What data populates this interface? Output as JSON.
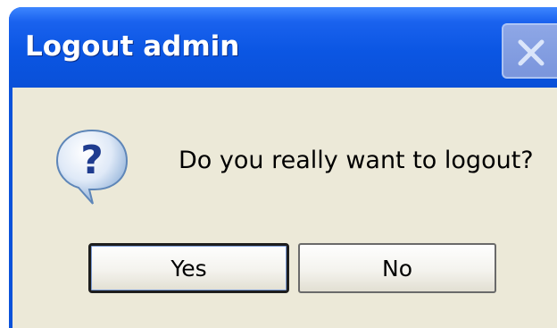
{
  "window": {
    "title": "Logout admin"
  },
  "dialog": {
    "icon": "question-icon",
    "message": "Do you really want to logout?",
    "buttons": {
      "yes_label": "Yes",
      "no_label": "No"
    }
  },
  "colors": {
    "titlebar": "#0b56e3",
    "client_bg": "#ece9d8",
    "button_border": "#003c74"
  }
}
